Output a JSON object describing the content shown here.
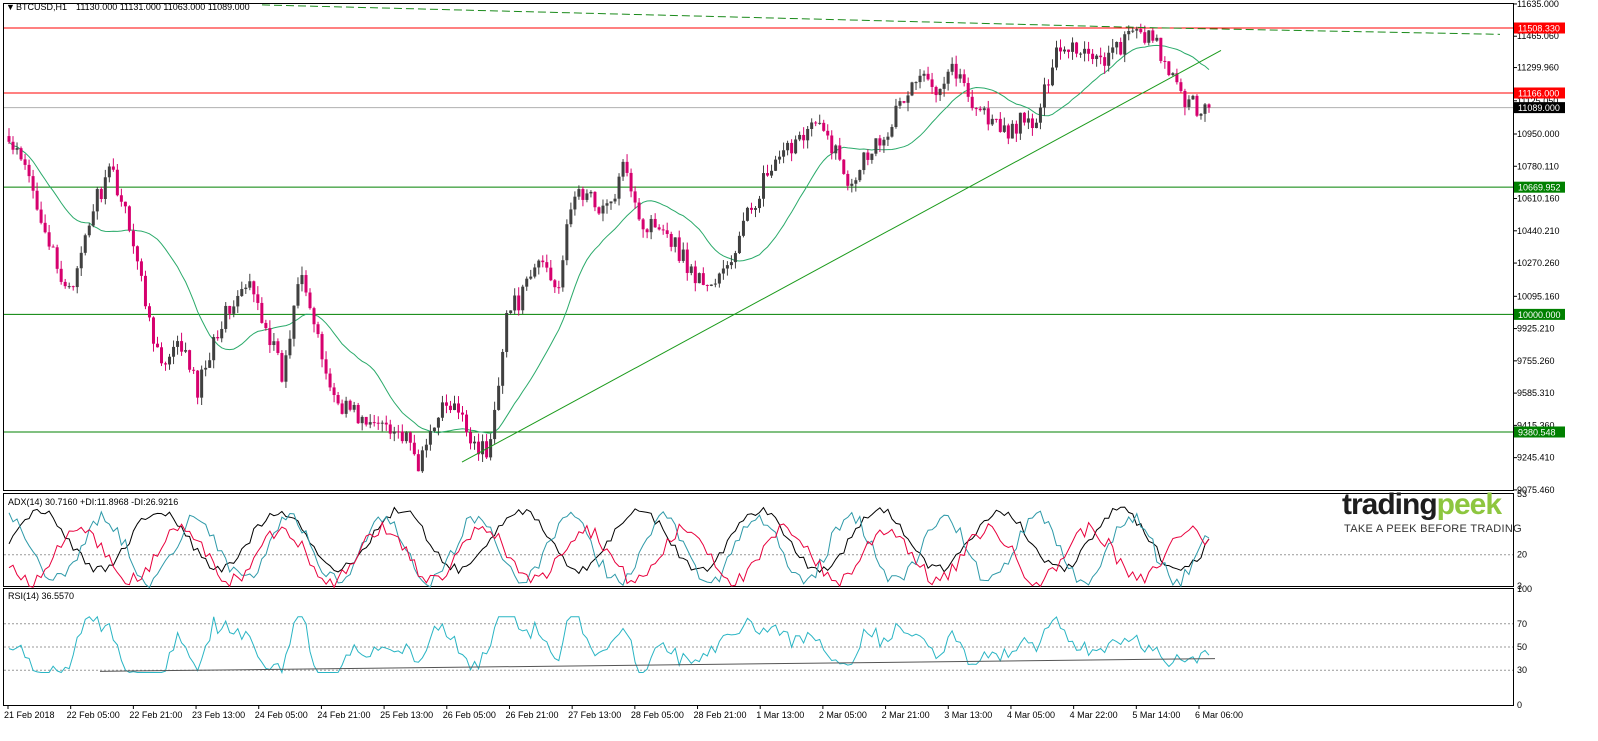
{
  "header": {
    "symbol": "BTCUSD,H1",
    "ohlc": "11130.000 11131.000 11063.000 11089.000"
  },
  "colors": {
    "bull": "#404040",
    "bear": "#d6006e",
    "ma": "#2aaa6a",
    "level_red": "#ff0000",
    "level_green": "#008000",
    "adx": "#000000",
    "plus_di": "#2f9aa9",
    "minus_di": "#e8003d",
    "rsi": "#2ab5c4"
  },
  "chart_data": [
    {
      "type": "candlestick",
      "name": "BTCUSD,H1",
      "ylim": [
        9075,
        11640
      ],
      "y_ticks": [
        "11635.000",
        "11465.060",
        "11299.960",
        "11125.050",
        "10950.000",
        "10780.110",
        "10610.160",
        "10440.210",
        "10270.260",
        "10095.160",
        "9925.210",
        "9755.260",
        "9585.310",
        "9415.360",
        "9245.410",
        "9075.460"
      ],
      "x_ticks": [
        "21 Feb 2018",
        "22 Feb 05:00",
        "22 Feb 21:00",
        "23 Feb 13:00",
        "24 Feb 05:00",
        "24 Feb 21:00",
        "25 Feb 13:00",
        "26 Feb 05:00",
        "26 Feb 21:00",
        "27 Feb 13:00",
        "28 Feb 05:00",
        "28 Feb 21:00",
        "1 Mar 13:00",
        "2 Mar 05:00",
        "2 Mar 21:00",
        "3 Mar 13:00",
        "4 Mar 05:00",
        "4 Mar 22:00",
        "5 Mar 14:00",
        "6 Mar 06:00"
      ],
      "close_path": [
        10900,
        10750,
        10500,
        10150,
        10200,
        10600,
        10750,
        10500,
        10050,
        9700,
        9850,
        9600,
        9900,
        10050,
        10150,
        9950,
        9650,
        10300,
        9850,
        9550,
        9500,
        9400,
        9450,
        9350,
        9200,
        9500,
        9500,
        9350,
        9250,
        10000,
        10100,
        10300,
        10150,
        10650,
        10600,
        10550,
        10800,
        10450,
        10500,
        10350,
        10200,
        10150,
        10250,
        10500,
        10700,
        10800,
        10950,
        11000,
        10900,
        10700,
        10850,
        10950,
        11100,
        11250,
        11200,
        11320,
        11150,
        11050,
        10950,
        11010,
        11000,
        11400,
        11420,
        11380,
        11350,
        11430,
        11500,
        11400,
        11200,
        11100,
        11089
      ],
      "levels": [
        {
          "label": "11508.330",
          "value": 11508.33,
          "color": "#ff0000"
        },
        {
          "label": "11166.000",
          "value": 11166,
          "color": "#ff0000"
        },
        {
          "label": "10669.952",
          "value": 10669.952,
          "color": "#008000"
        },
        {
          "label": "10000.000",
          "value": 10000,
          "color": "#008000"
        },
        {
          "label": "9380.548",
          "value": 9380.548,
          "color": "#008000"
        }
      ],
      "current_price": {
        "label": "11089.000",
        "value": 11089
      },
      "trendline": {
        "from": {
          "x": "26 Feb 05:00",
          "y": 9222
        },
        "to": {
          "x": "6 Mar 06:00",
          "y": 11390
        }
      },
      "dashed_resistance": {
        "from_y": 11630,
        "mid_y": 11510,
        "to_y": 11475
      }
    },
    {
      "type": "line",
      "name": "ADX(14)",
      "header": "ADX(14) 30.7160 +DI:11.8968 -DI:26.9216",
      "ylim": [
        3,
        53
      ],
      "y_ticks": [
        "53",
        "20",
        "3"
      ],
      "reference_line": 20
    },
    {
      "type": "line",
      "name": "RSI(14)",
      "header": "RSI(14) 36.5570",
      "ylim": [
        0,
        100
      ],
      "y_ticks": [
        "100",
        "70",
        "50",
        "30",
        "0"
      ],
      "reference_lines": [
        70,
        50,
        30
      ]
    }
  ],
  "brand": {
    "logo_left": "trading",
    "logo_right": "peek",
    "tagline": "TAKE A PEEK BEFORE TRADING"
  }
}
